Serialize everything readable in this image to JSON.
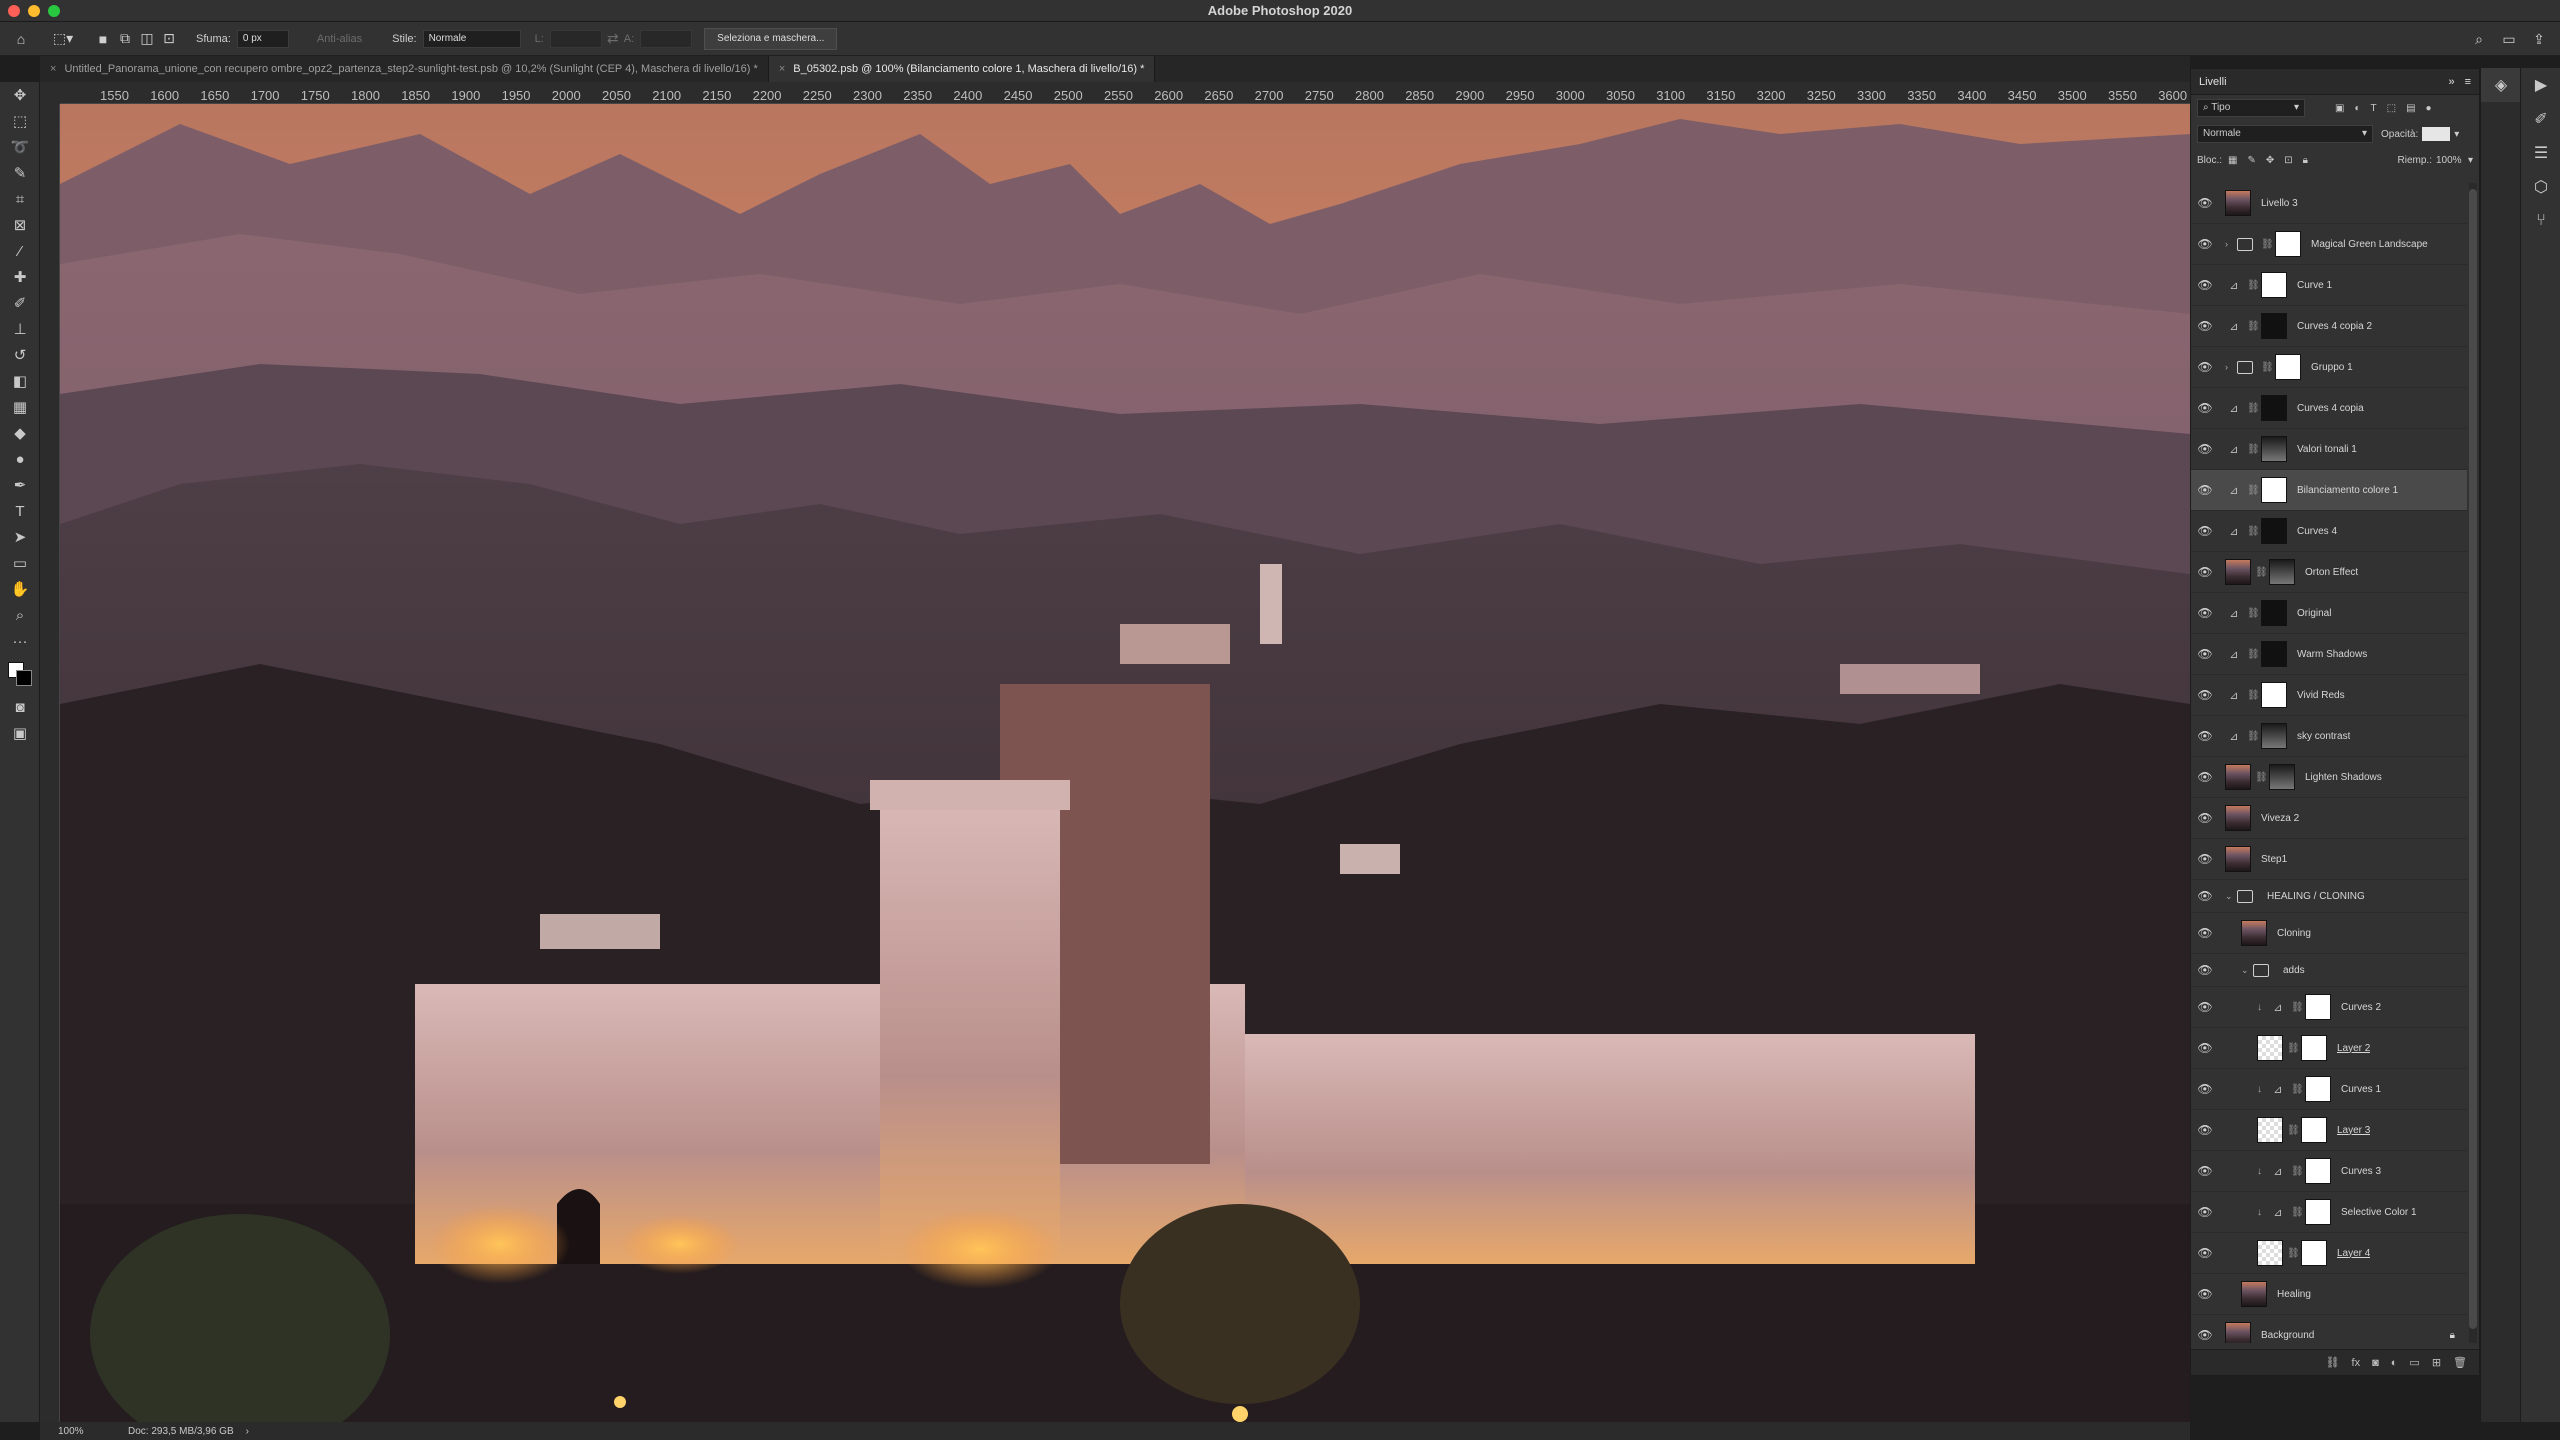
{
  "app": {
    "title": "Adobe Photoshop 2020"
  },
  "options_bar": {
    "feather_label": "Sfuma:",
    "feather_value": "0 px",
    "antialias_label": "Anti-alias",
    "style_label": "Stile:",
    "style_value": "Normale",
    "width_label": "L:",
    "height_label": "A:",
    "select_mask_button": "Seleziona e maschera..."
  },
  "tabs": [
    {
      "label": "Untitled_Panorama_unione_con recupero ombre_opz2_partenza_step2-sunlight-test.psb @ 10,2% (Sunlight (CEP 4), Maschera di livello/16) *"
    },
    {
      "label": "B_05302.psb @ 100% (Bilanciamento colore 1, Maschera di livello/16) *"
    }
  ],
  "ruler": {
    "ticks": [
      "1550",
      "1600",
      "1650",
      "1700",
      "1750",
      "1800",
      "1850",
      "1900",
      "1950",
      "2000",
      "2050",
      "2100",
      "2150",
      "2200",
      "2250",
      "2300",
      "2350",
      "2400",
      "2450",
      "2500",
      "2550",
      "2600",
      "2650",
      "2700",
      "2750",
      "2800",
      "2850",
      "2900",
      "2950",
      "3000",
      "3050",
      "3100",
      "3150",
      "3200",
      "3250",
      "3300",
      "3350",
      "3400",
      "3450",
      "3500",
      "3550",
      "3600"
    ]
  },
  "status_bar": {
    "zoom": "100%",
    "doc": "Doc: 293,5 MB/3,96 GB",
    "arrow": "›"
  },
  "layers_panel": {
    "title": "Livelli",
    "filter_kind": "Tipo",
    "blend_mode": "Normale",
    "opacity_label": "Opacità:",
    "lock_label": "Bloc.:",
    "fill_label": "Riemp.:",
    "fill_value": "100%",
    "layers": [
      {
        "name": "Livello 3",
        "thumb": "photo",
        "mask": "",
        "adj": "",
        "kind": "pixel"
      },
      {
        "name": "Magical Green Landscape",
        "thumb": "folder",
        "mask": "white",
        "adj": "",
        "kind": "group"
      },
      {
        "name": "Curve 1",
        "thumb": "",
        "mask": "white",
        "adj": "curves-icon",
        "kind": "adj"
      },
      {
        "name": "Curves 4 copia 2",
        "thumb": "",
        "mask": "black",
        "adj": "curves-icon",
        "kind": "adj"
      },
      {
        "name": "Gruppo 1",
        "thumb": "folder",
        "mask": "white",
        "adj": "",
        "kind": "group"
      },
      {
        "name": "Curves 4 copia",
        "thumb": "",
        "mask": "black",
        "adj": "curves-icon",
        "kind": "adj"
      },
      {
        "name": "Valori tonali 1",
        "thumb": "",
        "mask": "grad",
        "adj": "levels-icon",
        "kind": "adj"
      },
      {
        "name": "Bilanciamento colore 1",
        "thumb": "",
        "mask": "white",
        "adj": "color-balance-icon",
        "kind": "adj",
        "selected": true
      },
      {
        "name": "Curves 4",
        "thumb": "",
        "mask": "black",
        "adj": "curves-icon",
        "kind": "adj"
      },
      {
        "name": "Orton Effect",
        "thumb": "photo",
        "mask": "grad",
        "adj": "",
        "kind": "pixel"
      },
      {
        "name": "Original",
        "thumb": "",
        "mask": "black",
        "adj": "curves-icon",
        "kind": "adj"
      },
      {
        "name": "Warm Shadows",
        "thumb": "",
        "mask": "black",
        "adj": "photo-filter-icon",
        "kind": "adj"
      },
      {
        "name": "Vivid Reds",
        "thumb": "",
        "mask": "white",
        "adj": "hue-sat-icon",
        "kind": "adj"
      },
      {
        "name": "sky contrast",
        "thumb": "",
        "mask": "grad",
        "adj": "curves-icon",
        "kind": "adj"
      },
      {
        "name": "Lighten Shadows",
        "thumb": "photo",
        "mask": "grad",
        "adj": "",
        "kind": "pixel"
      },
      {
        "name": "Viveza 2",
        "thumb": "photo",
        "mask": "",
        "adj": "",
        "kind": "pixel"
      },
      {
        "name": "Step1",
        "thumb": "photo",
        "mask": "",
        "adj": "",
        "kind": "pixel"
      },
      {
        "name": "HEALING / CLONING",
        "thumb": "folder",
        "mask": "",
        "adj": "",
        "kind": "groupopen"
      },
      {
        "name": "Cloning",
        "thumb": "photo",
        "mask": "",
        "adj": "",
        "kind": "pixel",
        "indent": 1
      },
      {
        "name": "adds",
        "thumb": "folder",
        "mask": "",
        "adj": "",
        "kind": "groupopen",
        "indent": 1
      },
      {
        "name": "Curves 2",
        "thumb": "",
        "mask": "white",
        "adj": "curves-icon",
        "kind": "adj",
        "indent": 2
      },
      {
        "name": "Layer 2",
        "thumb": "check",
        "mask": "white",
        "adj": "",
        "kind": "pixel",
        "indent": 2,
        "underline": true
      },
      {
        "name": "Curves 1",
        "thumb": "",
        "mask": "white",
        "adj": "curves-icon",
        "kind": "adj",
        "indent": 2
      },
      {
        "name": "Layer 3",
        "thumb": "check",
        "mask": "white",
        "adj": "",
        "kind": "pixel",
        "indent": 2,
        "underline": true
      },
      {
        "name": "Curves 3",
        "thumb": "",
        "mask": "white",
        "adj": "curves-icon",
        "kind": "adj",
        "indent": 2
      },
      {
        "name": "Selective Color 1",
        "thumb": "",
        "mask": "white",
        "adj": "selective-color-icon",
        "kind": "adj",
        "indent": 2
      },
      {
        "name": "Layer 4",
        "thumb": "check",
        "mask": "white",
        "adj": "",
        "kind": "pixel",
        "indent": 2,
        "underline": true
      },
      {
        "name": "Healing",
        "thumb": "photo",
        "mask": "",
        "adj": "",
        "kind": "pixel",
        "indent": 1
      },
      {
        "name": "Background",
        "thumb": "photo",
        "mask": "",
        "adj": "",
        "kind": "pixel",
        "locked": true
      }
    ]
  }
}
